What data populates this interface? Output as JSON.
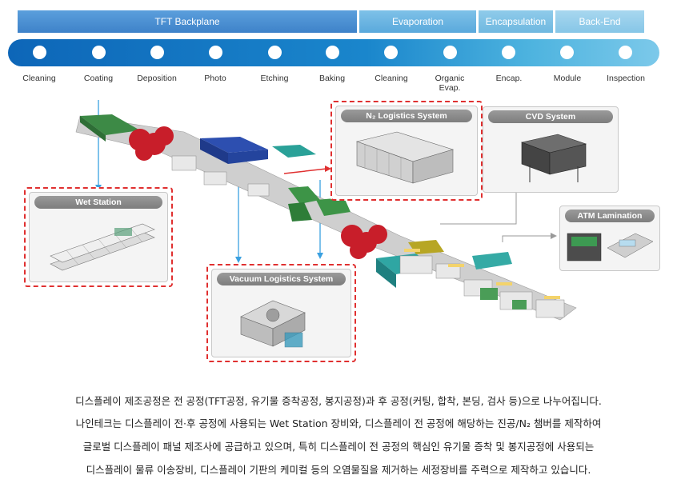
{
  "phases": {
    "tft": "TFT Backplane",
    "evap": "Evaporation",
    "encap": "Encapsulation",
    "back": "Back-End"
  },
  "steps": [
    {
      "label": "Cleaning"
    },
    {
      "label": "Coating"
    },
    {
      "label": "Deposition"
    },
    {
      "label": "Photo"
    },
    {
      "label": "Etching"
    },
    {
      "label": "Baking"
    },
    {
      "label": "Cleaning"
    },
    {
      "label": "Organic Evap."
    },
    {
      "label": "Encap."
    },
    {
      "label": "Module"
    },
    {
      "label": "Inspection"
    }
  ],
  "panels": {
    "wet_station": "Wet Station",
    "n2_logistics": "N₂ Logistics System",
    "cvd": "CVD System",
    "vacuum_logistics": "Vacuum Logistics System",
    "atm_lamination": "ATM Lamination"
  },
  "colors": {
    "bar_start": "#0d66b8",
    "bar_end": "#7cc9ea",
    "highlight_border": "#e03030",
    "arrow": "#3aa0e0"
  },
  "caption": {
    "line1": "디스플레이 제조공정은 전 공정(TFT공정, 유기물 증착공정, 봉지공정)과 후 공정(커팅, 합착, 본딩, 검사 등)으로 나누어집니다.",
    "line2": "나인테크는 디스플레이 전·후 공정에 사용되는 Wet Station 장비와, 디스플레이 전 공정에 해당하는 진공/N₂ 챔버를 제작하여",
    "line3": "글로벌 디스플레이 패널 제조사에 공급하고 있으며, 특히 디스플레이 전 공정의 핵심인 유기물 증착 및 봉지공정에 사용되는",
    "line4": "디스플레이 물류 이송장비, 디스플레이 기판의 케미컬 등의 오염물질을 제거하는 세정장비를 주력으로 제작하고 있습니다."
  }
}
